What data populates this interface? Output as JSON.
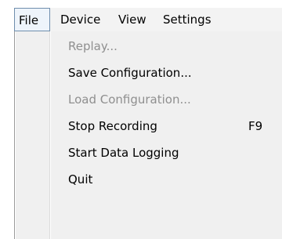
{
  "menubar": {
    "items": [
      {
        "label": "File"
      },
      {
        "label": "Device"
      },
      {
        "label": "View"
      },
      {
        "label": "Settings"
      }
    ]
  },
  "file_menu": {
    "items": [
      {
        "label": "Replay...",
        "enabled": false
      },
      {
        "label": "Save Configuration...",
        "enabled": true
      },
      {
        "label": "Load Configuration...",
        "enabled": false
      },
      {
        "label": "Stop Recording",
        "shortcut": "F9",
        "enabled": true
      },
      {
        "label": "Start Data Logging",
        "enabled": true
      },
      {
        "label": "Quit",
        "enabled": true
      }
    ]
  },
  "colors": {
    "menu_background": "#f0f0f0",
    "disabled_text": "#8f8f8f",
    "active_border": "#6f8ead"
  }
}
